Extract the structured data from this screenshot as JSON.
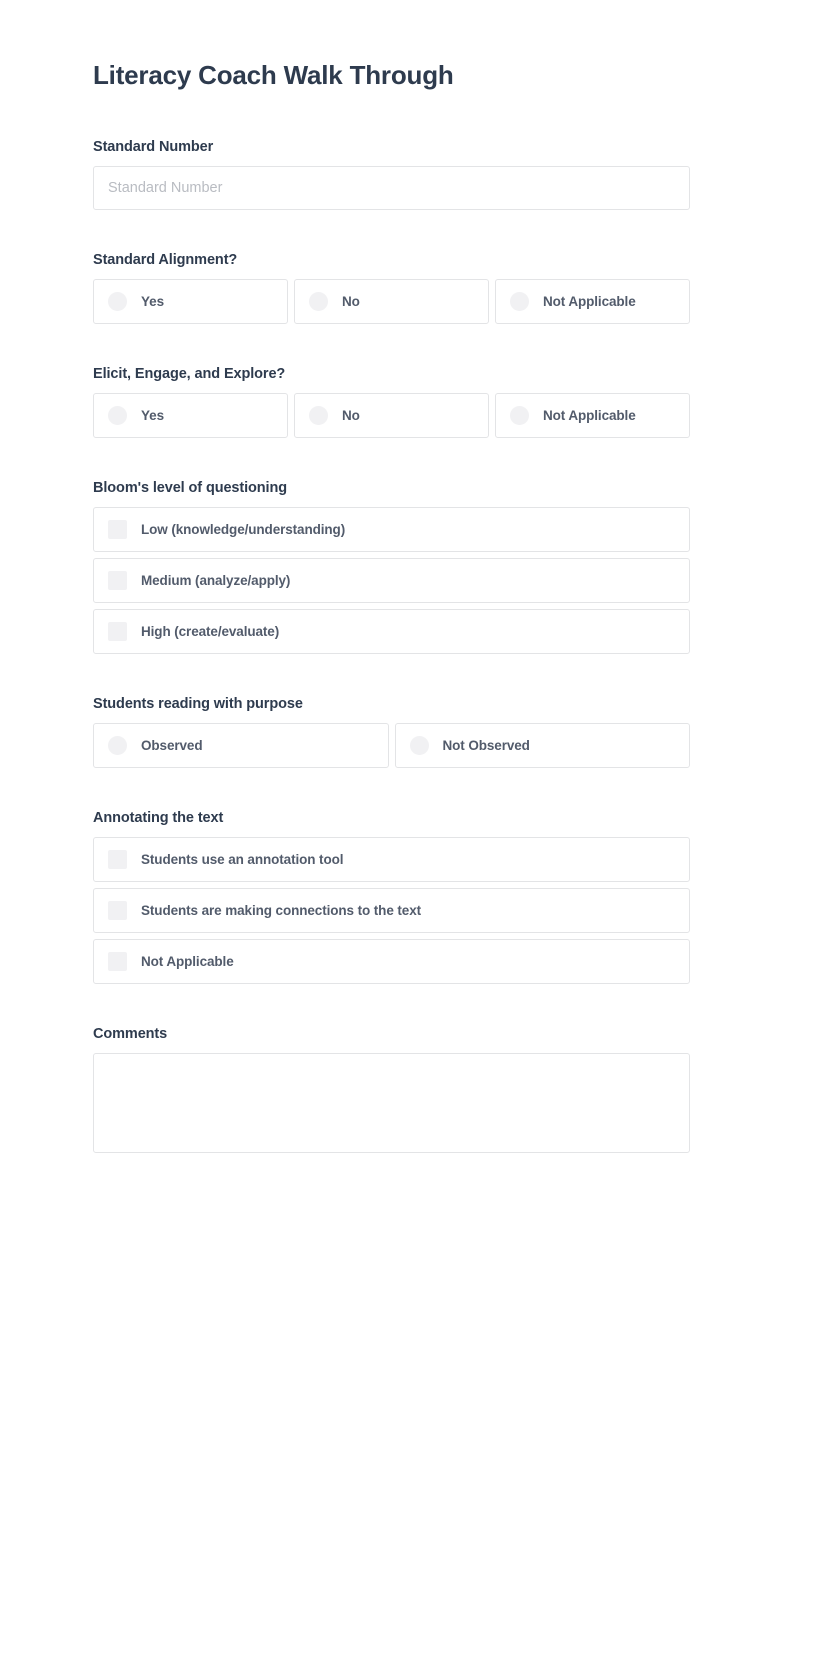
{
  "form": {
    "title": "Literacy Coach Walk Through",
    "fields": [
      {
        "name": "standard-number",
        "label": "Standard Number",
        "type": "text",
        "value": "",
        "placeholder": "Standard Number"
      },
      {
        "name": "standard-alignment",
        "label": "Standard Alignment?",
        "type": "radio-row",
        "options": [
          {
            "label": "Yes",
            "selected": false
          },
          {
            "label": "No",
            "selected": false
          },
          {
            "label": "Not Applicable",
            "selected": false
          }
        ]
      },
      {
        "name": "elicit-engage-explore",
        "label": "Elicit, Engage, and Explore?",
        "type": "radio-row",
        "options": [
          {
            "label": "Yes",
            "selected": false
          },
          {
            "label": "No",
            "selected": false
          },
          {
            "label": "Not Applicable",
            "selected": false
          }
        ]
      },
      {
        "name": "blooms-level-of-questioning",
        "label": "Bloom's level of questioning",
        "type": "checkbox-stack",
        "options": [
          {
            "label": "Low (knowledge/understanding)",
            "checked": false
          },
          {
            "label": "Medium (analyze/apply)",
            "checked": false
          },
          {
            "label": "High (create/evaluate)",
            "checked": false
          }
        ]
      },
      {
        "name": "students-reading-with-purpose",
        "label": "Students reading with purpose",
        "type": "radio-row",
        "options": [
          {
            "label": "Observed",
            "selected": false
          },
          {
            "label": "Not Observed",
            "selected": false
          }
        ]
      },
      {
        "name": "annotating-the-text",
        "label": "Annotating the text",
        "type": "checkbox-stack",
        "options": [
          {
            "label": "Students use an annotation tool",
            "checked": false
          },
          {
            "label": "Students are making connections to the text",
            "checked": false
          },
          {
            "label": "Not Applicable",
            "checked": false
          }
        ]
      },
      {
        "name": "comments",
        "label": "Comments",
        "type": "textarea",
        "value": "",
        "placeholder": ""
      }
    ]
  },
  "colors": {
    "heading": "#2e3b4e",
    "label_text": "#525b6b",
    "border": "#e3e4e6",
    "control_fill": "#f1f1f3",
    "placeholder": "#b9bcc2",
    "background": "#ffffff"
  }
}
